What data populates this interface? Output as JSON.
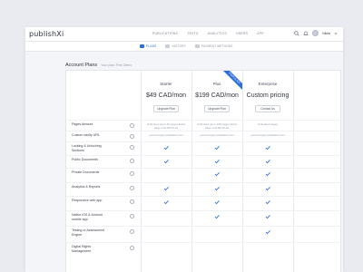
{
  "app": {
    "logo": "publishXi"
  },
  "nav": [
    "PUBLICATIONS",
    "TEXTS",
    "ANALYTICS",
    "USERS",
    "APP"
  ],
  "user": {
    "name": "Nikita"
  },
  "subtabs": [
    {
      "label": "PLANS",
      "active": true
    },
    {
      "label": "HISTORY",
      "active": false
    },
    {
      "label": "PAYMENT METHODS",
      "active": false
    }
  ],
  "section": {
    "title": "Account Plans",
    "subtitle": "Your plan: Free Demo"
  },
  "plans": [
    {
      "name": "Starter",
      "price": "$49 CAD/mon",
      "button": "Upgrade Plan",
      "ribbon": ""
    },
    {
      "name": "Plus",
      "price": "$199 CAD/mon",
      "button": "Upgrade Plan",
      "ribbon": "POPULAR"
    },
    {
      "name": "Enterprise",
      "price": "Custom pricing",
      "button": "Contact Us",
      "ribbon": ""
    }
  ],
  "features": [
    {
      "label": "Pages Amount",
      "cells": [
        "Unlimited upon 30 pages Extra page cost $0.20 ea",
        "Unlimited upon 100 pages Extra page cost $0.20 ea",
        "Unlimited pages"
      ]
    },
    {
      "label": "Custom vanity URL",
      "cells": [
        "yourcompany.publishxi.com",
        "yourcompany.publishxi.com",
        "yourcompany.publishxi.com"
      ]
    },
    {
      "label": "Locking & Unlocking Sections",
      "cells": [
        true,
        true,
        true
      ]
    },
    {
      "label": "Public Documents",
      "cells": [
        true,
        true,
        true
      ]
    },
    {
      "label": "Private Documents",
      "cells": [
        false,
        true,
        true
      ]
    },
    {
      "label": "Analytics & Reports",
      "cells": [
        true,
        true,
        true
      ]
    },
    {
      "label": "Responsive web app",
      "cells": [
        true,
        true,
        true
      ]
    },
    {
      "label": "Native iOS & Android mobile app",
      "cells": [
        false,
        true,
        true
      ]
    },
    {
      "label": "Testing or Assessment Engine",
      "cells": [
        false,
        false,
        true
      ]
    },
    {
      "label": "Digital Rights Management",
      "cells": [
        false,
        false,
        false
      ]
    }
  ],
  "colors": {
    "accent": "#2b6fd8",
    "check": "#2b6fd8",
    "background": "#e9ebf1"
  }
}
